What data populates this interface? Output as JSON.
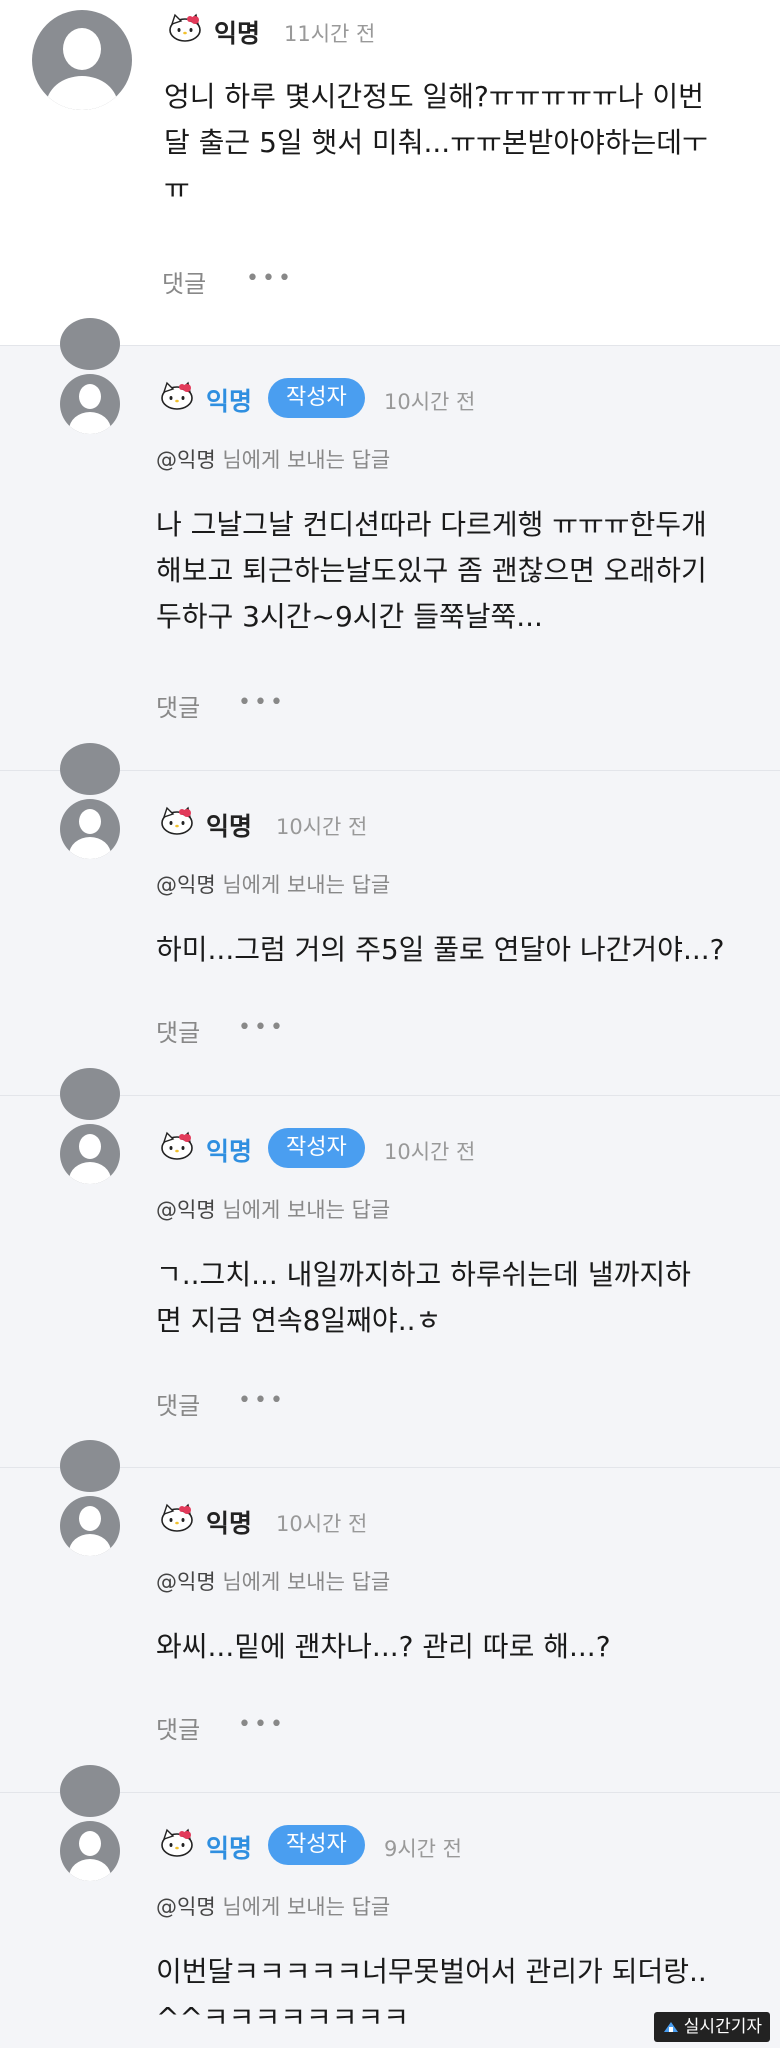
{
  "comments": [
    {
      "nickname": "익명",
      "time": "11시간 전",
      "text": "엉니 하루 몇시간정도 일해?ㅠㅠㅠㅠㅠ나 이번\n달 출근 5일 햇서 미춰...ㅠㅠ본받아야하는데ㅜ\nㅠ",
      "comment_label": "댓글",
      "more": "•••"
    },
    {
      "nickname": "익명",
      "author_badge": "작성자",
      "time": "10시간 전",
      "reply_to": "@익명",
      "reply_suffix": " 님에게 보내는 답글",
      "text": "나 그날그날 컨디션따라 다르게행 ㅠㅠㅠ한두개\n해보고 퇴근하는날도있구 좀 괜찮으면 오래하기\n두하구 3시간~9시간 들쭉날쭉...",
      "comment_label": "댓글",
      "more": "•••"
    },
    {
      "nickname": "익명",
      "time": "10시간 전",
      "reply_to": "@익명",
      "reply_suffix": " 님에게 보내는 답글",
      "text": "하미...그럼 거의 주5일 풀로 연달아 나간거야...?",
      "comment_label": "댓글",
      "more": "•••"
    },
    {
      "nickname": "익명",
      "author_badge": "작성자",
      "time": "10시간 전",
      "reply_to": "@익명",
      "reply_suffix": " 님에게 보내는 답글",
      "text": "ㄱ..그치... 내일까지하고 하루쉬는데 낼까지하\n면 지금 연속8일째야..ㅎ",
      "comment_label": "댓글",
      "more": "•••"
    },
    {
      "nickname": "익명",
      "time": "10시간 전",
      "reply_to": "@익명",
      "reply_suffix": " 님에게 보내는 답글",
      "text": "와씨...밑에 괜차나...? 관리 따로 해...?",
      "comment_label": "댓글",
      "more": "•••"
    },
    {
      "nickname": "익명",
      "author_badge": "작성자",
      "time": "9시간 전",
      "reply_to": "@익명",
      "reply_suffix": " 님에게 보내는 답글",
      "text": "이번달ㅋㅋㅋㅋㅋ너무못벌어서 관리가 되더랑..\n^^ㅋㅋㅋㅋㅋㅋㅋㅋ",
      "comment_label": null,
      "more": null
    }
  ],
  "watermark": "실시간기자",
  "colors": {
    "blue_nick": "#2f8fe0",
    "badge": "#4a9ef0",
    "reply_bg": "#f4f5f8",
    "avatar": "#8a8d92"
  },
  "icons": {
    "kitty": "hello-kitty-icon",
    "avatar": "avatar-icon",
    "more": "more-dots-icon"
  }
}
